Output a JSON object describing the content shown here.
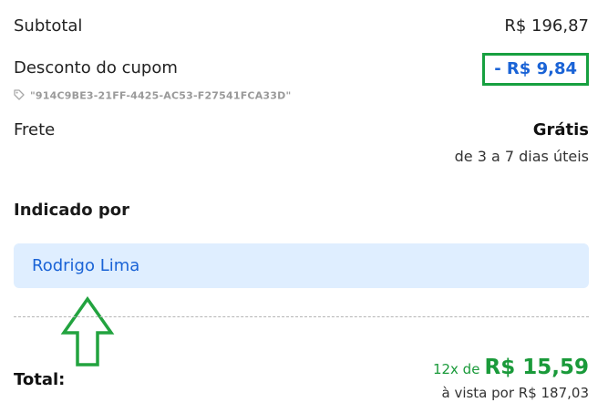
{
  "summary": {
    "subtotal_label": "Subtotal",
    "subtotal_value": "R$ 196,87",
    "discount_label": "Desconto do cupom",
    "discount_value": "- R$ 9,84",
    "coupon_code": "\"914C9BE3-21FF-4425-AC53-F27541FCA33D\"",
    "shipping_label": "Frete",
    "shipping_value": "Grátis",
    "shipping_time": "de 3 a 7 dias úteis"
  },
  "referral": {
    "title": "Indicado por",
    "name": "Rodrigo Lima"
  },
  "total": {
    "label": "Total:",
    "installment_prefix": "12x de",
    "installment_value": "R$ 15,59",
    "cash_price": "à vista por R$ 187,03"
  },
  "colors": {
    "accent_blue": "#1a63d6",
    "accent_green": "#1a9a3a",
    "highlight_border": "#17a040",
    "referral_bg": "#dfeeff"
  },
  "icons": {
    "coupon": "tag-icon",
    "annotation": "arrow-up-icon"
  }
}
